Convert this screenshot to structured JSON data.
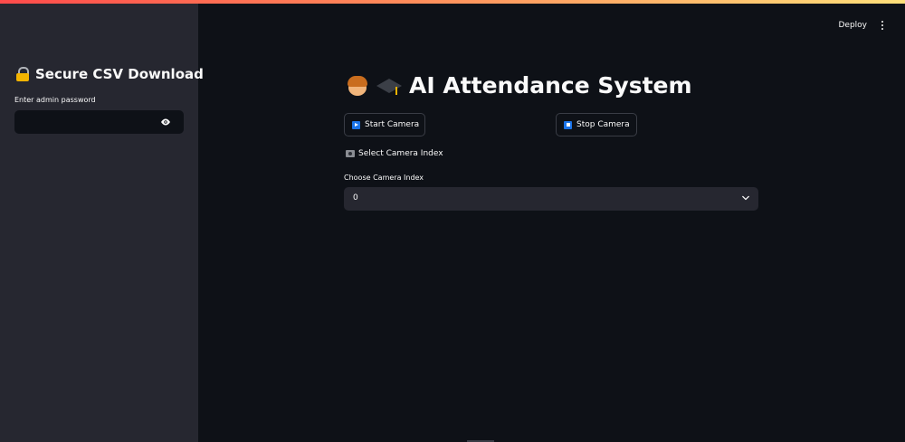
{
  "header": {
    "deploy_label": "Deploy",
    "menu_icon": "more-vertical-icon"
  },
  "sidebar": {
    "title": "Secure CSV Download",
    "title_icon": "lock-icon",
    "password_label": "Enter admin password",
    "password_value": "",
    "reveal_icon": "eye-icon"
  },
  "main": {
    "title": "AI Attendance System",
    "title_icons": [
      "person-emoji-icon",
      "graduation-cap-icon"
    ],
    "start_button": "Start Camera",
    "stop_button": "Stop Camera",
    "section_label": "Select Camera Index",
    "select_label": "Choose Camera Index",
    "select_value": "0"
  },
  "colors": {
    "background": "#0e1117",
    "sidebar": "#262730",
    "accent_gradient_start": "#ff4b4b",
    "accent_gradient_end": "#ffe07a",
    "button_icon": "#1a73e8"
  }
}
